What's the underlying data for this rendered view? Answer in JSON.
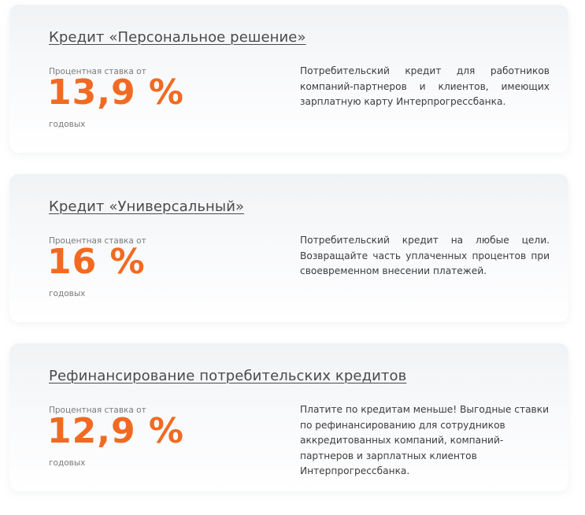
{
  "products": [
    {
      "title": "Кредит «Персональное решение»",
      "rate_label": "Процентная ставка от",
      "rate_value": "13,9 %",
      "rate_suffix": "годовых",
      "description": "Потребительский кредит для работников компаний-партнеров и клиентов, имеющих зарплатную карту Интерпрогрессбанка."
    },
    {
      "title": "Кредит «Универсальный»",
      "rate_label": "Процентная ставка от",
      "rate_value": "16 %",
      "rate_suffix": "годовых",
      "description": "Потребительский кредит на любые цели. Возвращайте часть уплаченных процентов при своевременном внесении платежей."
    },
    {
      "title": "Рефинансирование потребительских кредитов",
      "rate_label": "Процентная ставка от",
      "rate_value": "12,9 %",
      "rate_suffix": "годовых",
      "description": "Платите по кредитам меньше! Выгодные ставки по рефинансированию для сотрудников аккредитованных компаний, компаний-партнеров и зарплатных клиентов Интерпрогрессбанка."
    }
  ],
  "colors": {
    "accent": "#f26a21",
    "title_text": "#4a4a4a",
    "muted_text": "#7a7a7a",
    "body_text": "#3c3c3c"
  }
}
